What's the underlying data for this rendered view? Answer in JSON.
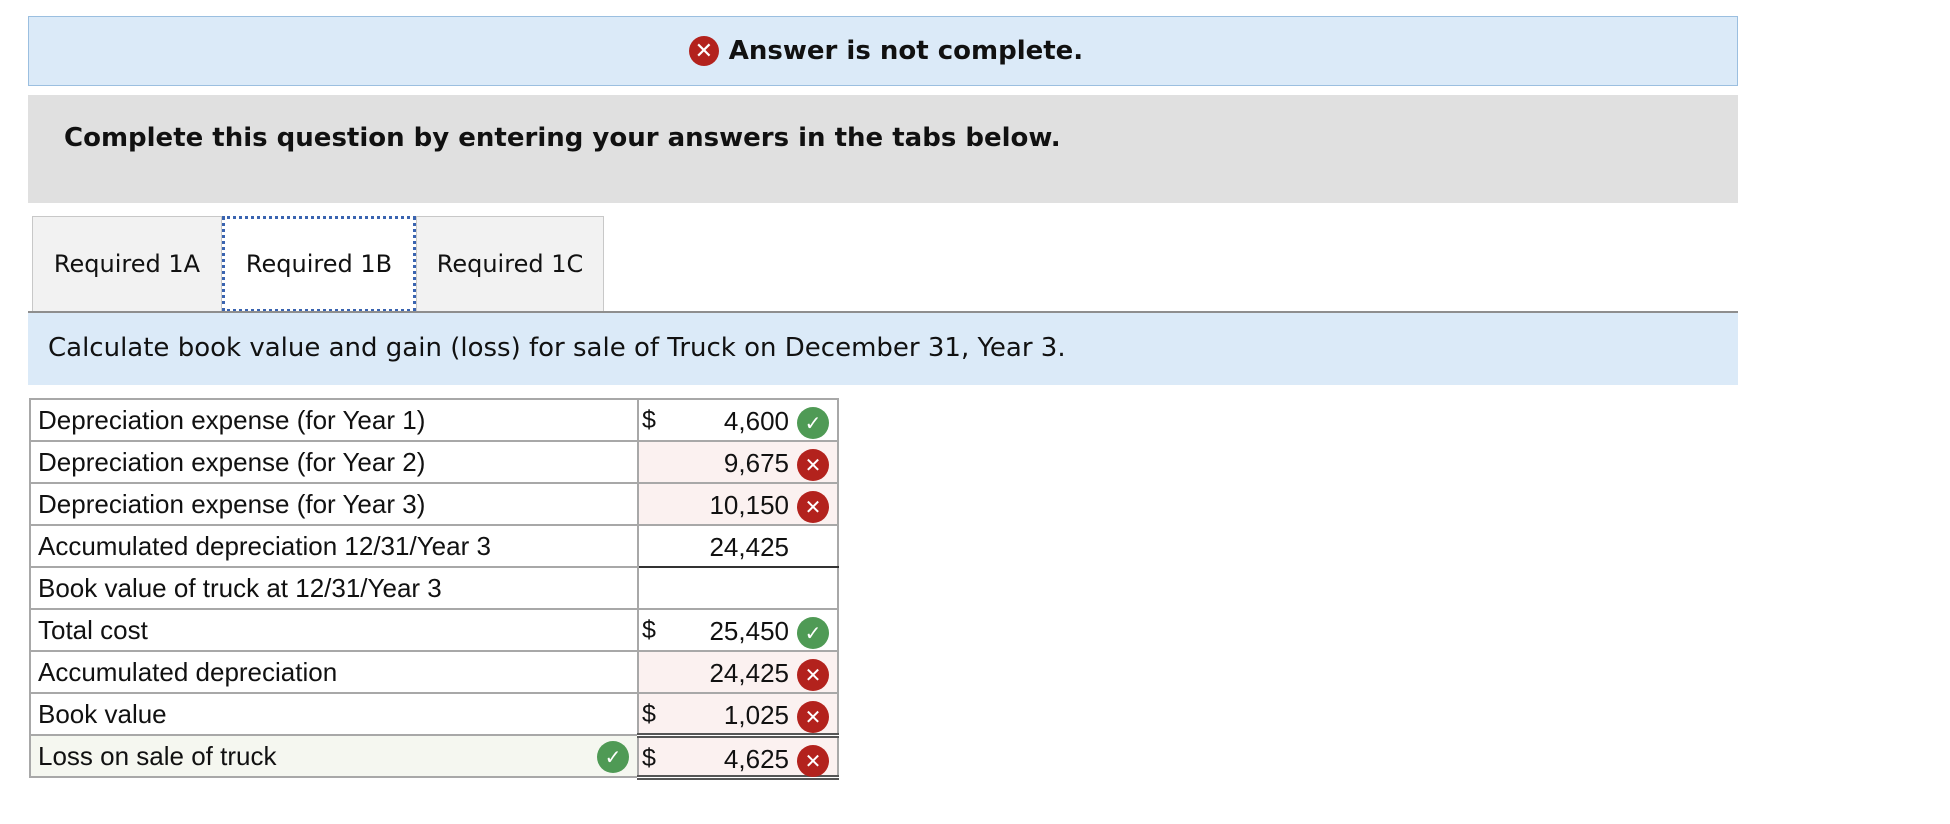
{
  "status": {
    "message": "Answer is not complete.",
    "icon": "x-circle-icon"
  },
  "instruction": "Complete this question by entering your answers in the tabs below.",
  "tabs": [
    {
      "label": "Required 1A",
      "active": false
    },
    {
      "label": "Required 1B",
      "active": true
    },
    {
      "label": "Required 1C",
      "active": false
    }
  ],
  "prompt": "Calculate book value and gain (loss) for sale of Truck on December 31, Year 3.",
  "colors": {
    "correct": "#4f9a55",
    "wrong": "#b3221d",
    "banner": "#dbeaf8"
  },
  "rows": [
    {
      "label": "Depreciation expense (for Year 1)",
      "dollar": "$",
      "value": "4,600",
      "mark": "correct"
    },
    {
      "label": "Depreciation expense (for Year 2)",
      "dollar": "",
      "value": "9,675",
      "mark": "wrong"
    },
    {
      "label": "Depreciation expense (for Year 3)",
      "dollar": "",
      "value": "10,150",
      "mark": "wrong"
    },
    {
      "label": "Accumulated depreciation 12/31/Year 3",
      "dollar": "",
      "value": "24,425",
      "mark": ""
    },
    {
      "label": "Book value of truck at 12/31/Year 3",
      "dollar": "",
      "value": "",
      "mark": ""
    },
    {
      "label": "Total cost",
      "dollar": "$",
      "value": "25,450",
      "mark": "correct"
    },
    {
      "label": "Accumulated depreciation",
      "dollar": "",
      "value": "24,425",
      "mark": "wrong"
    },
    {
      "label": "Book value",
      "dollar": "$",
      "value": "1,025",
      "mark": "wrong"
    },
    {
      "label": "Loss on sale of truck",
      "dollar": "$",
      "value": "4,625",
      "mark": "wrong",
      "label_mark": "correct"
    }
  ]
}
